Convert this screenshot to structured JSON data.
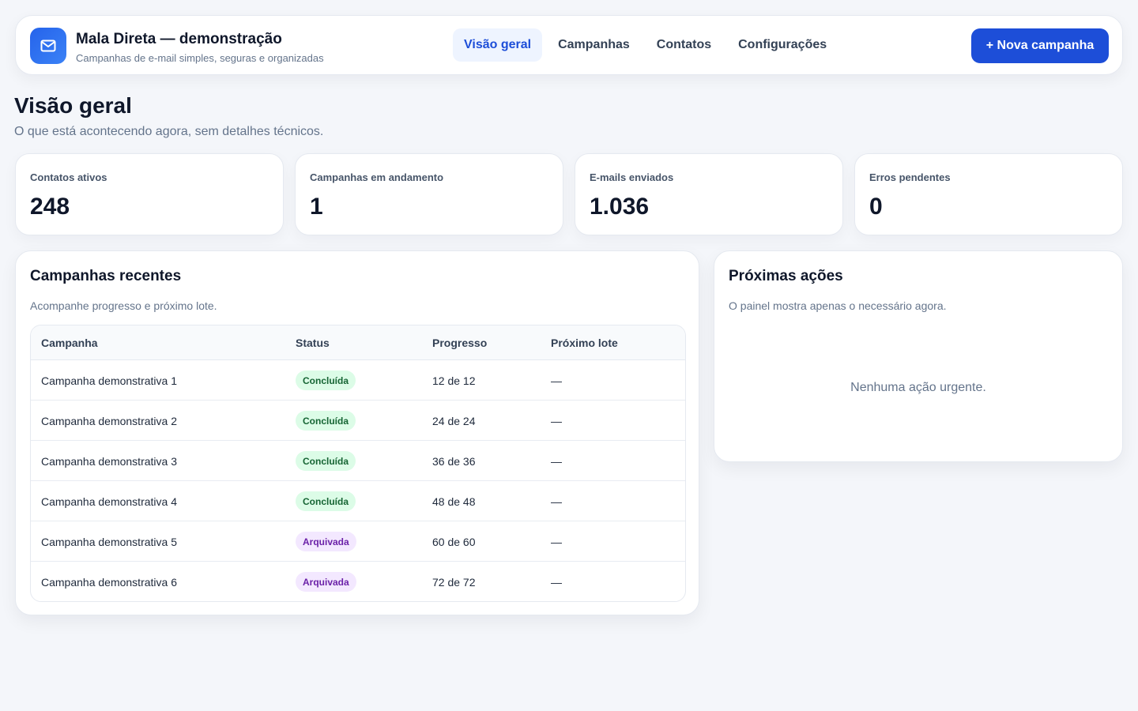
{
  "header": {
    "title": "Mala Direta — demonstração",
    "subtitle": "Campanhas de e-mail simples, seguras e organizadas",
    "logo_icon": "mail-icon",
    "nav": [
      {
        "label": "Visão geral",
        "active": true
      },
      {
        "label": "Campanhas",
        "active": false
      },
      {
        "label": "Contatos",
        "active": false
      },
      {
        "label": "Configurações",
        "active": false
      }
    ],
    "new_campaign_label": "+ Nova campanha"
  },
  "page": {
    "title": "Visão geral",
    "subtitle": "O que está acontecendo agora, sem detalhes técnicos."
  },
  "stats": [
    {
      "label": "Contatos ativos",
      "value": "248"
    },
    {
      "label": "Campanhas em andamento",
      "value": "1"
    },
    {
      "label": "E-mails enviados",
      "value": "1.036"
    },
    {
      "label": "Erros pendentes",
      "value": "0"
    }
  ],
  "recent": {
    "title": "Campanhas recentes",
    "subtitle": "Acompanhe progresso e próximo lote.",
    "columns": [
      "Campanha",
      "Status",
      "Progresso",
      "Próximo lote"
    ],
    "rows": [
      {
        "name": "Campanha demonstrativa 1",
        "status": "Concluída",
        "progress": "12 de 12",
        "next": "—"
      },
      {
        "name": "Campanha demonstrativa 2",
        "status": "Concluída",
        "progress": "24 de 24",
        "next": "—"
      },
      {
        "name": "Campanha demonstrativa 3",
        "status": "Concluída",
        "progress": "36 de 36",
        "next": "—"
      },
      {
        "name": "Campanha demonstrativa 4",
        "status": "Concluída",
        "progress": "48 de 48",
        "next": "—"
      },
      {
        "name": "Campanha demonstrativa 5",
        "status": "Arquivada",
        "progress": "60 de 60",
        "next": "—"
      },
      {
        "name": "Campanha demonstrativa 6",
        "status": "Arquivada",
        "progress": "72 de 72",
        "next": "—"
      }
    ]
  },
  "actions": {
    "title": "Próximas ações",
    "subtitle": "O painel mostra apenas o necessário agora.",
    "empty": "Nenhuma ação urgente."
  },
  "colors": {
    "accent": "#1d4ed8",
    "done_bg": "#dcfce7",
    "archived_bg": "#f3e8ff"
  }
}
